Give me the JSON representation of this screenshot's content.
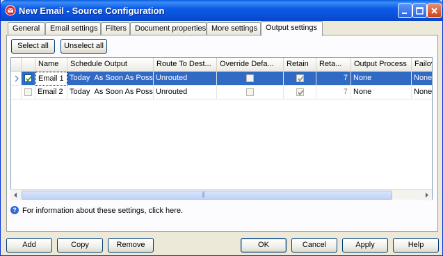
{
  "window": {
    "title": "New Email - Source Configuration"
  },
  "tabs": [
    {
      "label": "General"
    },
    {
      "label": "Email settings"
    },
    {
      "label": "Filters"
    },
    {
      "label": "Document properties"
    },
    {
      "label": "More settings"
    },
    {
      "label": "Output settings"
    }
  ],
  "active_tab": "Output settings",
  "toolbar": {
    "select_all": "Select all",
    "unselect_all": "Unselect all"
  },
  "grid": {
    "columns": [
      "Name",
      "Schedule Output",
      "Route To Dest...",
      "Override Defa...",
      "Retain",
      "Reta...",
      "Output Process",
      "Failove"
    ],
    "rows": [
      {
        "selected": true,
        "checked": true,
        "name": "Email 1",
        "schedule_day": "Today",
        "schedule_time": "As Soon As Possible",
        "route": "Unrouted",
        "override": false,
        "retain": true,
        "retain_days": "7",
        "output_process": "None",
        "failover": "None"
      },
      {
        "selected": false,
        "checked": false,
        "name": "Email 2",
        "schedule_day": "Today",
        "schedule_time": "As Soon As Possible",
        "route": "Unrouted",
        "override": false,
        "retain": true,
        "retain_days": "7",
        "output_process": "None",
        "failover": "None"
      }
    ],
    "scroll_grip": "|||"
  },
  "info": {
    "text": "For information about these settings, click here."
  },
  "footer": {
    "add": "Add",
    "copy": "Copy",
    "remove": "Remove",
    "ok": "OK",
    "cancel": "Cancel",
    "apply": "Apply",
    "help": "Help"
  },
  "colors": {
    "selection": "#316ac5",
    "titlebar": "#0a5fe0",
    "tab_accent": "#f0a03a"
  }
}
